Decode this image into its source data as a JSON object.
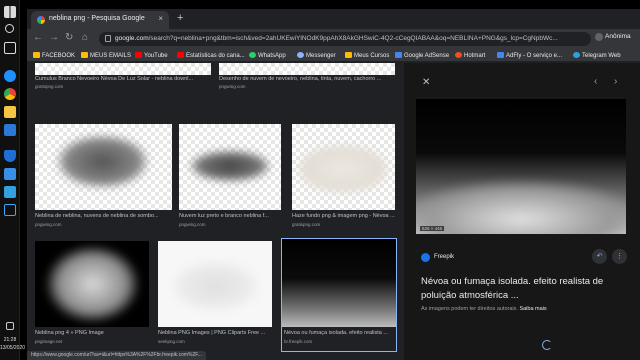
{
  "taskbar": {
    "icons": [
      "windows-logo",
      "search",
      "task-view",
      "edge",
      "chrome",
      "file-explorer",
      "store",
      "mail",
      "settings",
      "app"
    ],
    "time": "21:28",
    "date": "13/05/2020"
  },
  "tab": {
    "title": "neblina png - Pesquisa Google",
    "close": "×",
    "new_tab": "+"
  },
  "omnibox": {
    "host": "google.com",
    "rest": "/search?q=neblina+png&tbm=isch&ved=2ahUKEwiYlNOdK9ppAhX8AkGHSwiC-4Q2-cCegQIABAA&oq=NEBLINA+PNG&gs_lcp=CgNpbWc...",
    "profile": "Anônima"
  },
  "bookmarks": [
    {
      "label": "FACEBOOK",
      "color": "#fbbc05"
    },
    {
      "label": "MEUS EMAILS",
      "color": "#fbbc05"
    },
    {
      "label": "YouTube",
      "color": "#ff0000"
    },
    {
      "label": "Estatísticas do cana...",
      "color": "#ff0000"
    },
    {
      "label": "WhatsApp",
      "color": "#25d366"
    },
    {
      "label": "Messenger",
      "color": "#8ab4f8"
    },
    {
      "label": "Meus Cursos",
      "color": "#fbbc05"
    },
    {
      "label": "Google AdSense",
      "color": "#4285f4"
    },
    {
      "label": "Hotmart",
      "color": "#f04e23"
    },
    {
      "label": "AdFly - O serviço e...",
      "color": "#4285f4"
    },
    {
      "label": "Telegram Web",
      "color": "#2aa3e0"
    }
  ],
  "results": {
    "row1": [
      {
        "caption": "Cumulus Branco Nevoeiro Névoa De Luz Solar - neblina downl...",
        "source": "gratispng.com"
      },
      {
        "caption": "Desenho de nuvem de nevoeiro, neblina, tinta, nuvem, cachorro ...",
        "source": "pngwing.com"
      }
    ],
    "row2": [
      {
        "caption": "Neblina de neblina, nuvens de neblina de sombo...",
        "source": "pngwing.com"
      },
      {
        "caption": "Nuvem luz preto e branco neblina f...",
        "source": "pngwing.com"
      },
      {
        "caption": "Haze fundo png & imagem png - Névoa ...",
        "source": "gratispng.com"
      }
    ],
    "row3": [
      {
        "caption": "Neblina png 4 » PNG Image",
        "source": "pngimage.net"
      },
      {
        "caption": "Neblina PNG Images | PNG Cliparts Free ...",
        "source": "seekpng.com"
      },
      {
        "caption": "Névoa ou fumaça isolada. efeito realista ...",
        "source": "br.freepik.com"
      }
    ]
  },
  "preview": {
    "size": "626 × 446",
    "source": "Freepik",
    "title": "Névoa ou fumaça isolada. efeito realista de poluição atmosférica ...",
    "note": "As imagens podem ter direitos autorais.",
    "note_link": "Saiba mais"
  },
  "status_url": "https://www.google.com/url?sa=i&url=https%3A%2F%2Fbr.freepik.com%2F..."
}
